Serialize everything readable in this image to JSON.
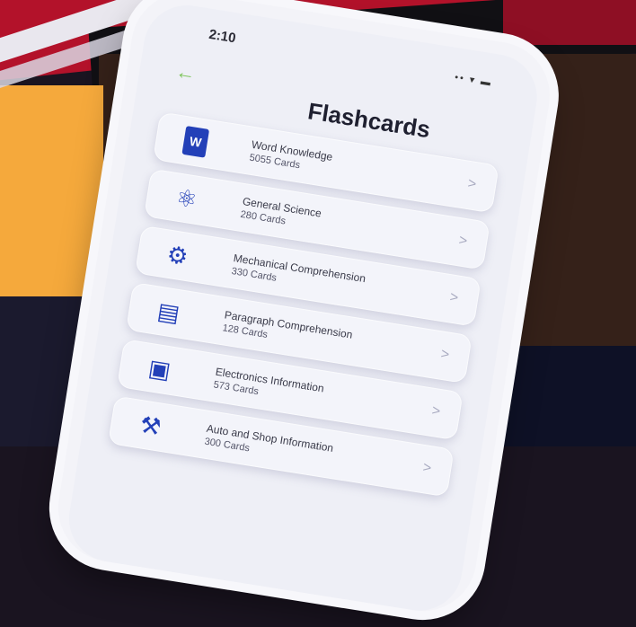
{
  "status": {
    "time": "2:10",
    "icons": "•• ▾ ▬"
  },
  "header": {
    "back": "←",
    "title": "Flashcards"
  },
  "items": [
    {
      "name": "Word Knowledge",
      "count": "5055 Cards",
      "icon": "word-doc-icon",
      "glyph": "W"
    },
    {
      "name": "General Science",
      "count": "280 Cards",
      "icon": "atom-icon",
      "glyph": "⚛"
    },
    {
      "name": "Mechanical Comprehension",
      "count": "330 Cards",
      "icon": "gear-icon",
      "glyph": "⚙"
    },
    {
      "name": "Paragraph Comprehension",
      "count": "128 Cards",
      "icon": "book-icon",
      "glyph": "▤"
    },
    {
      "name": "Electronics Information",
      "count": "573 Cards",
      "icon": "chip-icon",
      "glyph": "▣"
    },
    {
      "name": "Auto and Shop Information",
      "count": "300 Cards",
      "icon": "tools-icon",
      "glyph": "⚒"
    }
  ],
  "chevron": ">"
}
